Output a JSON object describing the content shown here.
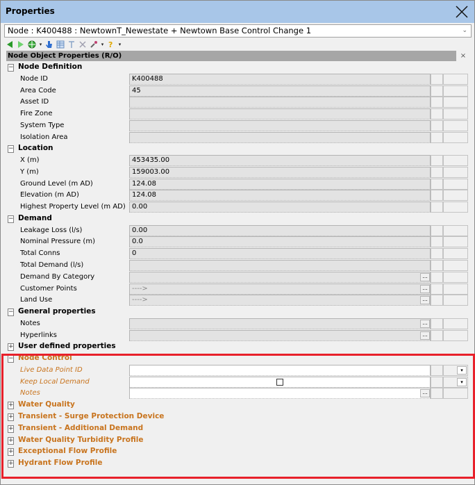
{
  "window": {
    "title": "Properties",
    "close_icon": "close-icon"
  },
  "node_selector": {
    "value": "Node : K400488 : NewtownT_Newestate + Newtown Base Control Change 1"
  },
  "toolbar": {
    "icons": [
      "back-arrow-icon",
      "forward-arrow-icon",
      "globe-icon",
      "hand-pointer-icon",
      "grid-icon",
      "text-icon",
      "delete-icon",
      "wrench-icon",
      "help-icon"
    ]
  },
  "pane": {
    "header": "Node Object Properties (R/O)",
    "close_glyph": "×"
  },
  "categories": {
    "node_definition": {
      "label": "Node Definition",
      "toggle": "−",
      "rows": [
        {
          "label": "Node ID",
          "value": "K400488"
        },
        {
          "label": "Area Code",
          "value": "45"
        },
        {
          "label": "Asset ID",
          "value": ""
        },
        {
          "label": "Fire Zone",
          "value": ""
        },
        {
          "label": "System Type",
          "value": ""
        },
        {
          "label": "Isolation Area",
          "value": ""
        }
      ]
    },
    "location": {
      "label": "Location",
      "toggle": "−",
      "rows": [
        {
          "label": "X (m)",
          "value": "453435.00"
        },
        {
          "label": "Y (m)",
          "value": "159003.00"
        },
        {
          "label": "Ground Level (m AD)",
          "value": "124.08"
        },
        {
          "label": "Elevation (m AD)",
          "value": "124.08"
        },
        {
          "label": "Highest Property Level (m AD)",
          "value": "0.00"
        }
      ]
    },
    "demand": {
      "label": "Demand",
      "toggle": "−",
      "rows": [
        {
          "label": "Leakage Loss (l/s)",
          "value": "0.00"
        },
        {
          "label": "Nominal Pressure (m)",
          "value": "0.0"
        },
        {
          "label": "Total Conns",
          "value": "0"
        },
        {
          "label": "Total Demand (l/s)",
          "value": ""
        },
        {
          "label": "Demand By Category",
          "value": "",
          "ellipsis": "..."
        },
        {
          "label": "Customer Points",
          "value": "---->",
          "ellipsis": "..."
        },
        {
          "label": "Land Use",
          "value": "---->",
          "ellipsis": "..."
        }
      ]
    },
    "general": {
      "label": "General properties",
      "toggle": "−",
      "rows": [
        {
          "label": "Notes",
          "value": "",
          "ellipsis": "..."
        },
        {
          "label": "Hyperlinks",
          "value": "",
          "ellipsis": "..."
        }
      ]
    },
    "user_defined": {
      "label": "User defined properties",
      "toggle": "+"
    },
    "node_control": {
      "label": "Node Control",
      "toggle": "−",
      "rows": [
        {
          "label": "Live Data Point ID",
          "value": "",
          "dropdown": "▾"
        },
        {
          "label": "Keep Local Demand",
          "value": "",
          "checked": false,
          "dropdown": "▾"
        },
        {
          "label": "Notes",
          "value": "",
          "ellipsis": "..."
        }
      ]
    },
    "collapsed": [
      {
        "label": "Water Quality",
        "toggle": "+"
      },
      {
        "label": "Transient - Surge Protection Device",
        "toggle": "+"
      },
      {
        "label": "Transient - Additional Demand",
        "toggle": "+"
      },
      {
        "label": "Water Quality Turbidity Profile",
        "toggle": "+"
      },
      {
        "label": "Exceptional Flow Profile",
        "toggle": "+"
      },
      {
        "label": "Hydrant Flow Profile",
        "toggle": "+"
      }
    ]
  },
  "colors": {
    "title_bar": "#a8c6e8",
    "header_bar": "#a6a6a6",
    "orange_text": "#c8741e",
    "highlight_border": "#e8202a"
  }
}
